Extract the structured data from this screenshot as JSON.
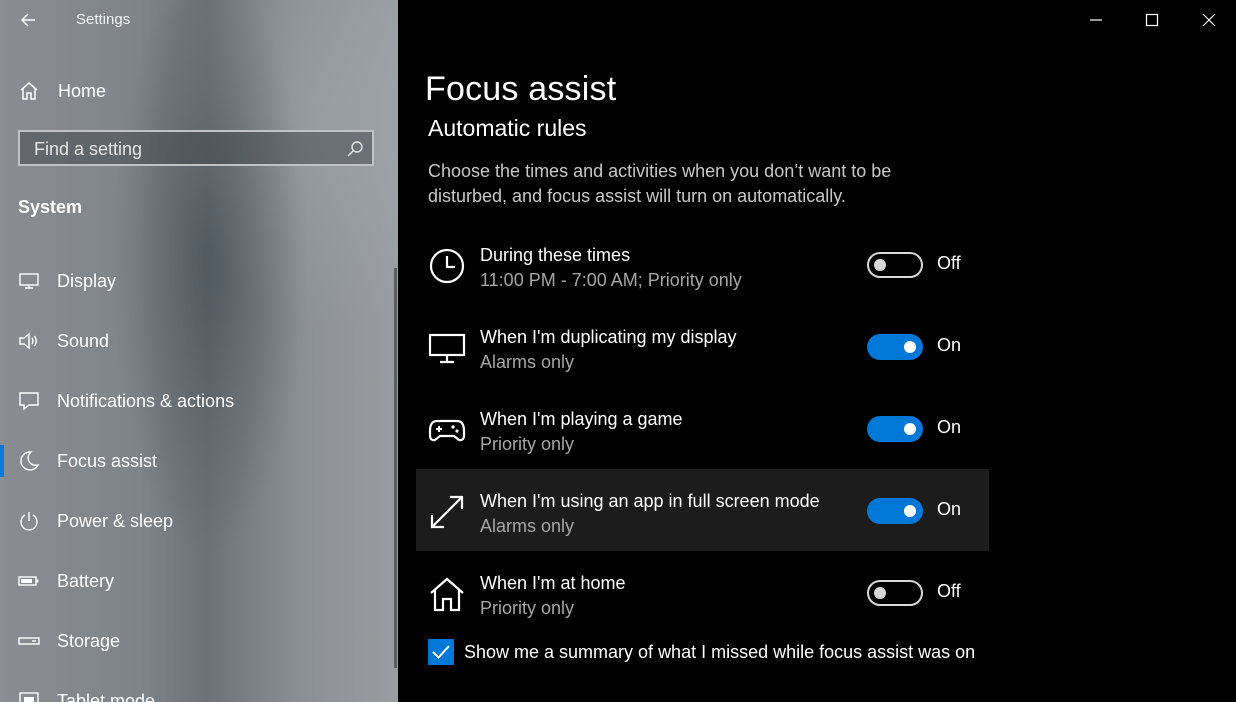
{
  "window": {
    "app_title": "Settings",
    "controls": [
      "minimize-icon",
      "maximize-icon",
      "close-icon"
    ]
  },
  "sidebar": {
    "home_label": "Home",
    "search_placeholder": "Find a setting",
    "section_title": "System",
    "items": [
      {
        "label": "Display",
        "icon": "display-icon"
      },
      {
        "label": "Sound",
        "icon": "sound-icon"
      },
      {
        "label": "Notifications & actions",
        "icon": "notifications-icon"
      },
      {
        "label": "Focus assist",
        "icon": "moon-icon",
        "active": true
      },
      {
        "label": "Power & sleep",
        "icon": "power-icon"
      },
      {
        "label": "Battery",
        "icon": "battery-icon"
      },
      {
        "label": "Storage",
        "icon": "storage-icon"
      },
      {
        "label": "Tablet mode",
        "icon": "tablet-icon"
      }
    ]
  },
  "main": {
    "page_title": "Focus assist",
    "subheading": "Automatic rules",
    "description": "Choose the times and activities when you don’t want to be disturbed, and focus assist will turn on automatically.",
    "rules": [
      {
        "name": "During these times",
        "detail": "11:00 PM - 7:00 AM; Priority only",
        "state": "Off",
        "on": false,
        "icon": "clock-icon"
      },
      {
        "name": "When I'm duplicating my display",
        "detail": "Alarms only",
        "state": "On",
        "on": true,
        "icon": "monitor-icon"
      },
      {
        "name": "When I'm playing a game",
        "detail": "Priority only",
        "state": "On",
        "on": true,
        "icon": "gamepad-icon"
      },
      {
        "name": "When I'm using an app in full screen mode",
        "detail": "Alarms only",
        "state": "On",
        "on": true,
        "icon": "fullscreen-icon"
      },
      {
        "name": "When I'm at home",
        "detail": "Priority only",
        "state": "Off",
        "on": false,
        "icon": "house-icon"
      }
    ],
    "summary_label": "Show me a summary of what I missed while focus assist was on",
    "summary_checked": true
  },
  "colors": {
    "accent": "#0078d7",
    "background": "#000000",
    "secondary_text": "#a6a6a6"
  }
}
